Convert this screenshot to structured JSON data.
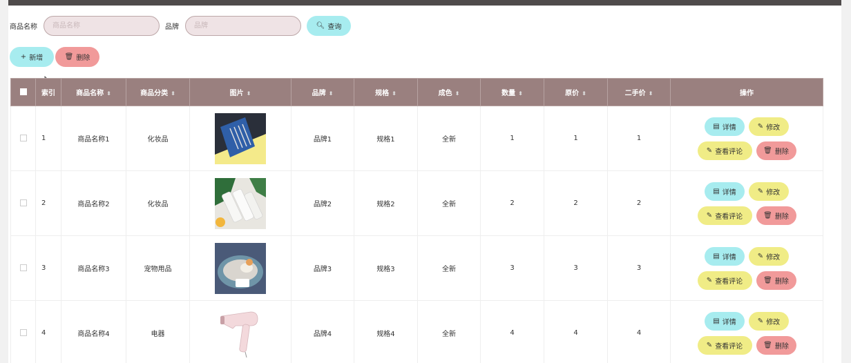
{
  "search": {
    "name_label": "商品名称",
    "name_placeholder": "商品名称",
    "brand_label": "品牌",
    "brand_placeholder": "品牌",
    "query_label": "查询"
  },
  "actions": {
    "add_label": "新增",
    "delete_label": "删除"
  },
  "table": {
    "headers": {
      "index": "索引",
      "name": "商品名称",
      "category": "商品分类",
      "image": "图片",
      "brand": "品牌",
      "spec": "规格",
      "condition": "成色",
      "quantity": "数量",
      "price": "原价",
      "used_price": "二手价",
      "ops": "操作"
    },
    "op_labels": {
      "detail": "详情",
      "edit": "修改",
      "comments": "查看评论",
      "delete": "删除"
    },
    "rows": [
      {
        "index": "1",
        "name": "商品名称1",
        "category": "化妆品",
        "brand": "品牌1",
        "spec": "规格1",
        "condition": "全新",
        "quantity": "1",
        "price": "1",
        "used_price": "1"
      },
      {
        "index": "2",
        "name": "商品名称2",
        "category": "化妆品",
        "brand": "品牌2",
        "spec": "规格2",
        "condition": "全新",
        "quantity": "2",
        "price": "2",
        "used_price": "2"
      },
      {
        "index": "3",
        "name": "商品名称3",
        "category": "宠物用品",
        "brand": "品牌3",
        "spec": "规格3",
        "condition": "全新",
        "quantity": "3",
        "price": "3",
        "used_price": "3"
      },
      {
        "index": "4",
        "name": "商品名称4",
        "category": "电器",
        "brand": "品牌4",
        "spec": "规格4",
        "condition": "全新",
        "quantity": "4",
        "price": "4",
        "used_price": "4"
      }
    ]
  },
  "colors": {
    "header_bg": "#9a807f",
    "cyan": "#a7ecef",
    "yellow": "#f0ec86",
    "red": "#f19a9a"
  }
}
